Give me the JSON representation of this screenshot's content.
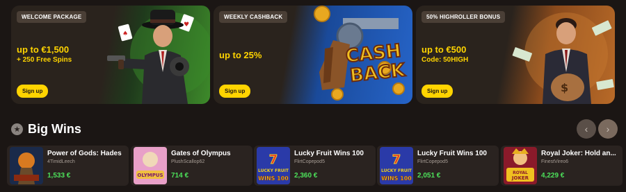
{
  "promos": [
    {
      "badge": "WELCOME PACKAGE",
      "title": "up to €1,500",
      "subtitle": "+ 250 Free Spins",
      "button": "Sign up"
    },
    {
      "badge": "WEEKLY CASHBACK",
      "title": "up to 25%",
      "subtitle": "",
      "button": "Sign up",
      "art_text_1": "CASH",
      "art_text_2": "BACK"
    },
    {
      "badge": "50% HIGHROLLER BONUS",
      "title": "up to €500",
      "subtitle": "Code: 50HIGH",
      "button": "Sign up"
    }
  ],
  "big_wins": {
    "title": "Big Wins",
    "prev_label": "‹",
    "next_label": "›",
    "items": [
      {
        "game": "Power of Gods: Hades",
        "user": "4TimidLeech",
        "amount": "1,533 €"
      },
      {
        "game": "Gates of Olympus",
        "user": "PlushScallop62",
        "amount": "714 €"
      },
      {
        "game": "Lucky Fruit Wins 100",
        "user": "FlirtCopepod5",
        "amount": "2,360 €"
      },
      {
        "game": "Lucky Fruit Wins 100",
        "user": "FlirtCopepod5",
        "amount": "2,051 €"
      },
      {
        "game": "Royal Joker: Hold an...",
        "user": "FinestVireo6",
        "amount": "4,229 €"
      }
    ]
  },
  "thumb_texts": {
    "olympus": "OLYMPUS",
    "lucky": "LUCKY FRUIT",
    "wins100": "WINS 100",
    "royal": "ROYAL",
    "joker": "JOKER"
  },
  "colors": {
    "accent_yellow": "#ffd400",
    "win_green": "#4ce05a",
    "background": "#1b1614",
    "card": "#2a2320"
  }
}
